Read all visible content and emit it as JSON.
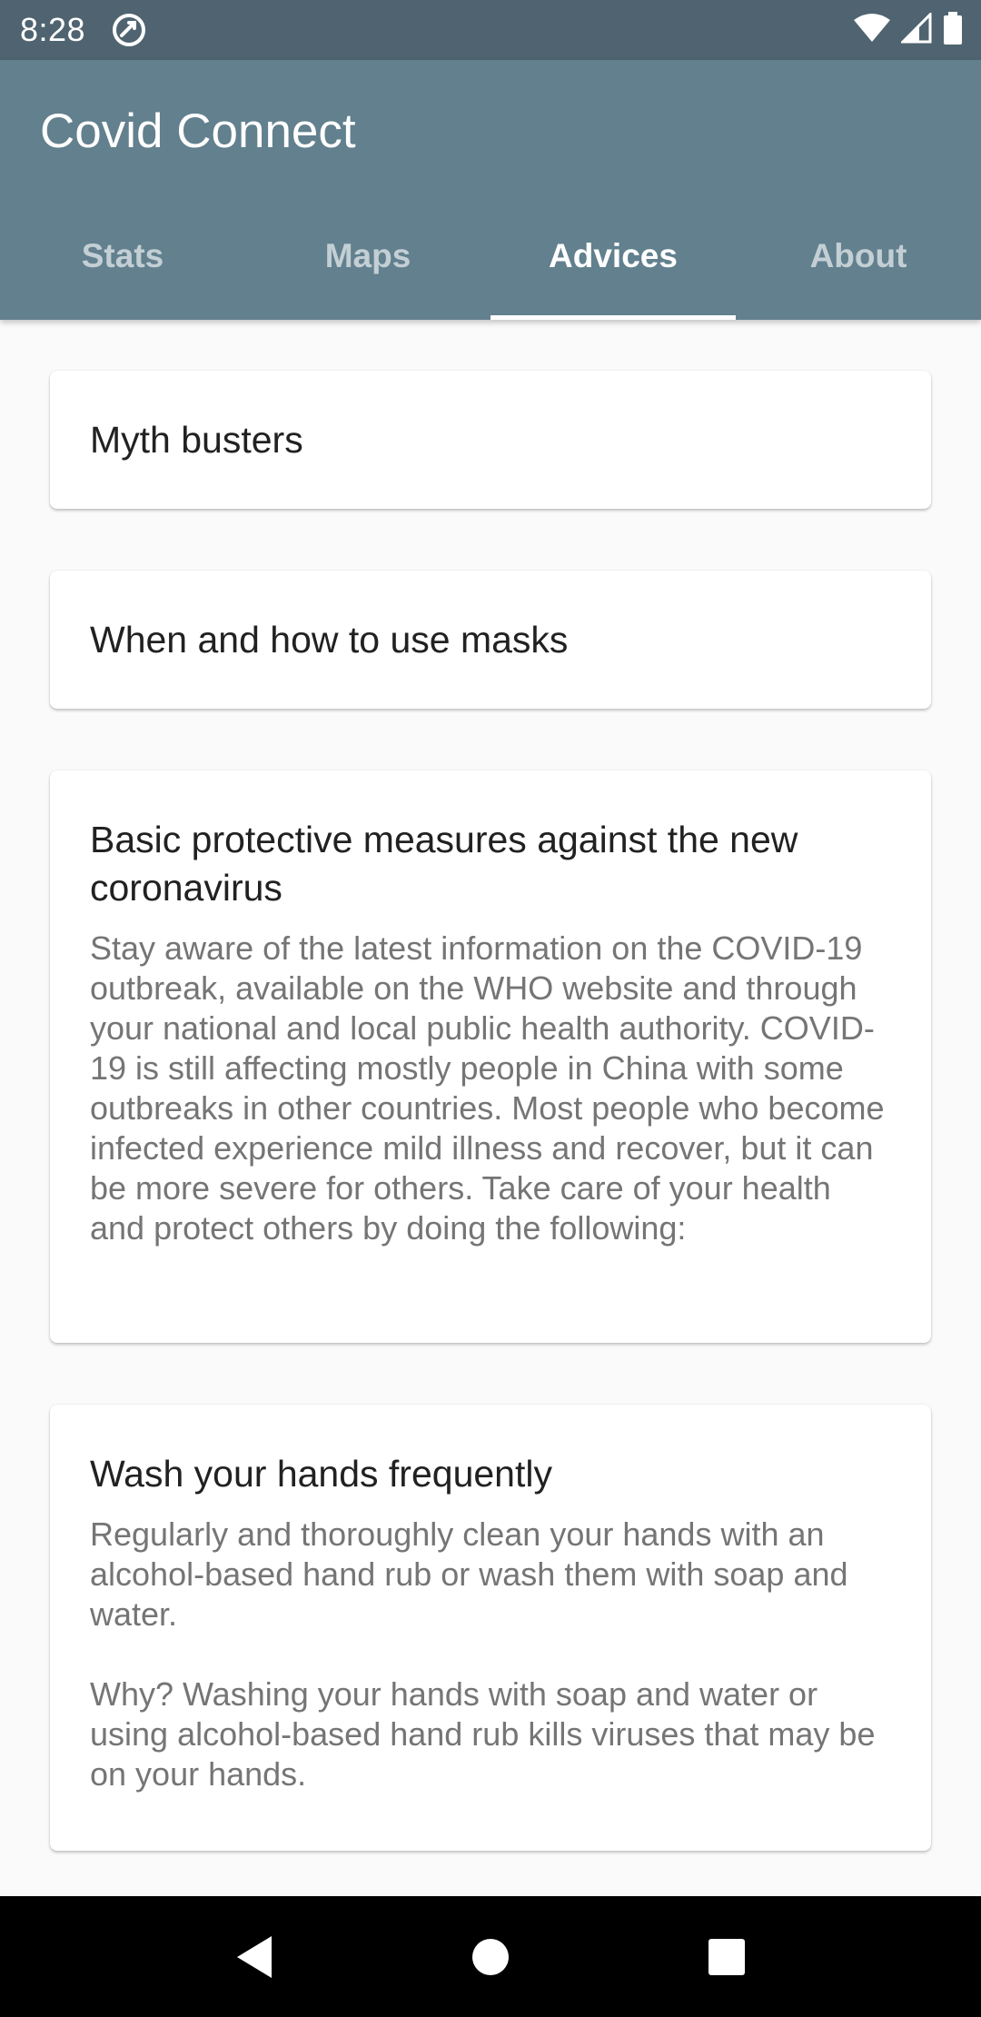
{
  "status_bar": {
    "time": "8:28",
    "icons": [
      "sync-icon",
      "wifi-icon",
      "signal-icon",
      "battery-icon"
    ]
  },
  "app": {
    "title": "Covid Connect",
    "colors": {
      "status_bar": "#4f6470",
      "app_bar": "#62808e",
      "background": "#fafafa"
    }
  },
  "tabs": [
    {
      "label": "Stats",
      "active": false
    },
    {
      "label": "Maps",
      "active": false
    },
    {
      "label": "Advices",
      "active": true
    },
    {
      "label": "About",
      "active": false
    }
  ],
  "cards": [
    {
      "title": "Myth busters"
    },
    {
      "title": "When and how to use masks"
    },
    {
      "title": "Basic protective measures against the new coronavirus",
      "body": "Stay aware of the latest information on the COVID-19 outbreak, available on the WHO website and through your national and local public health authority. COVID-19 is still affecting mostly people in China with some outbreaks in other countries. Most people who become infected experience mild illness and recover, but it can be more severe for others. Take care of your health and protect others by doing the following:"
    },
    {
      "title": "Wash your hands frequently",
      "body": "Regularly and thoroughly clean your hands with an alcohol-based hand rub or wash them with soap and water.\n\nWhy? Washing your hands with soap and water or using alcohol-based hand rub kills viruses that may be on your hands."
    }
  ],
  "nav_bar": {
    "icons": [
      "back-icon",
      "home-icon",
      "recents-icon"
    ]
  }
}
